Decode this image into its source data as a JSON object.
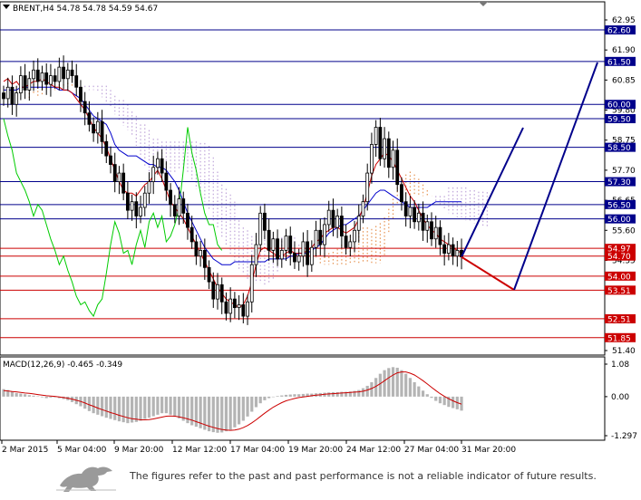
{
  "header": {
    "symbol_line": "BRENT,H4  54.78 54.78 54.59 54.67",
    "macd_label": "MACD(12,26,9) -0.465 -0.349"
  },
  "disclaimer": "The figures refer to the past and past performance is not a reliable indicator of future results.",
  "colors": {
    "blue_level": "#00008b",
    "red_level": "#cc0000",
    "candle": "#000000",
    "tenkan": "#cc0000",
    "kijun": "#0000cc",
    "chikou": "#00cc00",
    "cloud_orange": "#e07a2a",
    "cloud_purple": "#b08fd0",
    "forecast_up": "#00008b",
    "forecast_down": "#cc0000",
    "macd_hist": "#b4b4b4",
    "macd_signal": "#cc0000"
  },
  "chart_data": {
    "type": "candlestick",
    "instrument": "BRENT",
    "timeframe": "H4",
    "ohlc_header": {
      "open": 54.78,
      "high": 54.78,
      "low": 54.59,
      "close": 54.67
    },
    "ylim": [
      51.0,
      63.5
    ],
    "y_ticks": [
      62.95,
      61.9,
      60.85,
      59.8,
      58.75,
      57.7,
      56.65,
      55.6,
      54.55,
      53.5,
      52.45,
      51.4
    ],
    "x_tick_labels": [
      "2 Mar 2015",
      "5 Mar 04:00",
      "9 Mar 20:00",
      "12 Mar 12:00",
      "17 Mar 04:00",
      "19 Mar 20:00",
      "24 Mar 12:00",
      "27 Mar 04:00",
      "31 Mar 20:00"
    ],
    "levels": [
      {
        "value": 62.6,
        "label": "62.60",
        "color": "blue"
      },
      {
        "value": 61.5,
        "label": "61.50",
        "color": "blue"
      },
      {
        "value": 60.0,
        "label": "60.00",
        "color": "blue"
      },
      {
        "value": 59.5,
        "label": "59.50",
        "color": "blue"
      },
      {
        "value": 58.5,
        "label": "58.50",
        "color": "blue"
      },
      {
        "value": 57.3,
        "label": "57.30",
        "color": "blue"
      },
      {
        "value": 56.5,
        "label": "56.50",
        "color": "blue"
      },
      {
        "value": 56.0,
        "label": "56.00",
        "color": "blue"
      },
      {
        "value": 54.97,
        "label": "54.97",
        "color": "red"
      },
      {
        "value": 54.7,
        "label": "54.70",
        "color": "red"
      },
      {
        "value": 54.0,
        "label": "54.00",
        "color": "red"
      },
      {
        "value": 53.51,
        "label": "53.51",
        "color": "red"
      },
      {
        "value": 52.51,
        "label": "52.51",
        "color": "red"
      },
      {
        "value": 51.85,
        "label": "51.85",
        "color": "red"
      }
    ],
    "closes": [
      60.2,
      60.6,
      60.0,
      60.4,
      61.0,
      60.5,
      60.9,
      61.2,
      60.8,
      61.1,
      60.7,
      61.0,
      60.8,
      61.3,
      60.9,
      61.2,
      61.0,
      60.6,
      60.1,
      59.7,
      59.3,
      59.0,
      59.4,
      58.7,
      58.2,
      57.9,
      57.3,
      57.6,
      56.9,
      56.3,
      56.6,
      56.1,
      56.4,
      56.9,
      57.3,
      57.8,
      58.1,
      57.6,
      57.0,
      56.5,
      56.1,
      56.7,
      56.2,
      55.7,
      55.2,
      54.7,
      54.9,
      54.3,
      53.8,
      53.2,
      53.7,
      53.1,
      52.7,
      53.2,
      52.9,
      53.0,
      52.6,
      53.1,
      54.4,
      55.1,
      56.2,
      55.6,
      54.9,
      55.3,
      54.6,
      54.9,
      55.4,
      54.8,
      54.5,
      54.7,
      55.2,
      54.4,
      55.0,
      55.6,
      55.1,
      55.8,
      56.3,
      55.7,
      56.1,
      55.4,
      55.0,
      55.2,
      55.6,
      56.1,
      56.6,
      57.6,
      58.6,
      59.2,
      58.1,
      58.8,
      57.8,
      58.4,
      57.2,
      56.6,
      56.1,
      56.4,
      55.9,
      56.2,
      55.6,
      55.9,
      55.3,
      55.7,
      55.1,
      54.8,
      55.1,
      54.7,
      54.9,
      54.67
    ],
    "tenkan": [
      60.8,
      60.9,
      60.7,
      60.8,
      60.6,
      60.6,
      60.7,
      60.8,
      60.8,
      60.9,
      60.8,
      60.7,
      60.6,
      60.6,
      60.5,
      60.5,
      60.4,
      60.2,
      60.0,
      59.8,
      59.5,
      59.2,
      59.0,
      58.8,
      58.5,
      58.1,
      57.7,
      57.3,
      57.0,
      56.9,
      56.9,
      56.8,
      57.0,
      57.2,
      57.3,
      57.5,
      57.7,
      57.4,
      57.0,
      56.6,
      56.4,
      56.2,
      56.0,
      55.7,
      55.4,
      55.1,
      54.8,
      54.5,
      54.2,
      53.9,
      53.6,
      53.4,
      53.2,
      53.1,
      53.0,
      52.9,
      53.0,
      53.3,
      53.8,
      54.4,
      54.9,
      55.0,
      54.9,
      54.8,
      54.7,
      54.7,
      54.8,
      54.9,
      54.8,
      54.8,
      54.8,
      54.9,
      55.0,
      55.2,
      55.3,
      55.5,
      55.6,
      55.7,
      55.7,
      55.6,
      55.5,
      55.6,
      55.7,
      56.0,
      56.4,
      56.9,
      57.5,
      57.9,
      58.1,
      58.3,
      58.2,
      58.0,
      57.7,
      57.4,
      57.1,
      56.8,
      56.6,
      56.3,
      56.0,
      55.8,
      55.6,
      55.5,
      55.3,
      55.2,
      55.1,
      55.0,
      54.9,
      54.8
    ],
    "kijun": [
      60.5,
      60.5,
      60.5,
      60.5,
      60.6,
      60.6,
      60.6,
      60.6,
      60.6,
      60.6,
      60.6,
      60.6,
      60.6,
      60.5,
      60.5,
      60.5,
      60.4,
      60.3,
      60.2,
      60.0,
      59.8,
      59.6,
      59.5,
      59.4,
      59.3,
      59.0,
      58.6,
      58.4,
      58.3,
      58.2,
      58.2,
      58.2,
      58.1,
      58.0,
      57.9,
      57.9,
      57.8,
      57.8,
      57.7,
      57.5,
      57.3,
      57.0,
      56.6,
      56.2,
      55.9,
      55.6,
      55.3,
      55.0,
      54.8,
      54.6,
      54.5,
      54.4,
      54.4,
      54.4,
      54.5,
      54.5,
      54.5,
      54.5,
      54.5,
      54.5,
      54.5,
      54.5,
      54.6,
      54.6,
      54.6,
      54.6,
      54.6,
      54.7,
      54.7,
      54.8,
      54.8,
      54.8,
      54.9,
      55.0,
      55.1,
      55.3,
      55.5,
      55.6,
      55.7,
      55.8,
      55.8,
      55.9,
      56.0,
      56.1,
      56.3,
      56.5,
      56.7,
      56.9,
      57.0,
      57.0,
      56.9,
      56.8,
      56.7,
      56.6,
      56.5,
      56.4,
      56.4,
      56.4,
      56.4,
      56.4,
      56.5,
      56.6,
      56.6,
      56.6,
      56.6,
      56.6,
      56.6,
      56.6
    ],
    "chikou": [
      59.5,
      58.9,
      58.4,
      57.6,
      57.3,
      57.0,
      56.6,
      56.1,
      56.5,
      56.3,
      55.8,
      55.3,
      54.9,
      54.4,
      54.7,
      54.2,
      53.8,
      53.3,
      53.0,
      53.1,
      52.8,
      52.6,
      53.0,
      53.2,
      54.1,
      55.1,
      55.9,
      55.5,
      54.8,
      54.9,
      54.4,
      55.1,
      55.6,
      55.0,
      55.9,
      56.2,
      55.7,
      56.1,
      55.2,
      55.4,
      55.8,
      56.4,
      57.7,
      59.2,
      58.3,
      57.7,
      56.9,
      56.2,
      55.8,
      55.8,
      55.1,
      54.9
    ]
  },
  "macd_data": {
    "ylim": [
      -1.297,
      1.08
    ],
    "y_ticks": [
      1.08,
      0.0,
      -1.297
    ],
    "hist": [
      0.25,
      0.22,
      0.18,
      0.12,
      0.1,
      0.08,
      0.05,
      0.03,
      0.01,
      -0.02,
      -0.05,
      -0.03,
      -0.02,
      -0.05,
      -0.08,
      -0.12,
      -0.18,
      -0.25,
      -0.32,
      -0.4,
      -0.48,
      -0.55,
      -0.6,
      -0.65,
      -0.7,
      -0.74,
      -0.78,
      -0.82,
      -0.85,
      -0.88,
      -0.86,
      -0.84,
      -0.8,
      -0.74,
      -0.7,
      -0.65,
      -0.6,
      -0.55,
      -0.55,
      -0.6,
      -0.66,
      -0.72,
      -0.8,
      -0.88,
      -0.95,
      -1.0,
      -1.05,
      -1.1,
      -1.15,
      -1.18,
      -1.2,
      -1.19,
      -1.15,
      -1.1,
      -1.02,
      -0.92,
      -0.8,
      -0.66,
      -0.5,
      -0.35,
      -0.22,
      -0.12,
      -0.05,
      0.0,
      0.02,
      0.04,
      0.06,
      0.07,
      0.08,
      0.08,
      0.09,
      0.1,
      0.1,
      0.11,
      0.12,
      0.13,
      0.14,
      0.15,
      0.15,
      0.16,
      0.16,
      0.17,
      0.19,
      0.22,
      0.28,
      0.36,
      0.48,
      0.62,
      0.76,
      0.88,
      0.95,
      0.98,
      0.96,
      0.88,
      0.76,
      0.62,
      0.48,
      0.34,
      0.2,
      0.08,
      -0.04,
      -0.14,
      -0.22,
      -0.28,
      -0.34,
      -0.38,
      -0.42,
      -0.465
    ],
    "signal": [
      0.2,
      0.19,
      0.17,
      0.16,
      0.14,
      0.12,
      0.11,
      0.09,
      0.07,
      0.05,
      0.03,
      0.02,
      0.01,
      -0.01,
      -0.03,
      -0.05,
      -0.08,
      -0.12,
      -0.16,
      -0.21,
      -0.27,
      -0.32,
      -0.38,
      -0.43,
      -0.48,
      -0.53,
      -0.57,
      -0.62,
      -0.66,
      -0.7,
      -0.73,
      -0.75,
      -0.77,
      -0.77,
      -0.76,
      -0.74,
      -0.71,
      -0.68,
      -0.65,
      -0.64,
      -0.65,
      -0.67,
      -0.7,
      -0.74,
      -0.78,
      -0.83,
      -0.88,
      -0.93,
      -0.98,
      -1.02,
      -1.06,
      -1.09,
      -1.11,
      -1.12,
      -1.11,
      -1.08,
      -1.03,
      -0.96,
      -0.87,
      -0.77,
      -0.66,
      -0.55,
      -0.45,
      -0.35,
      -0.27,
      -0.2,
      -0.14,
      -0.1,
      -0.06,
      -0.03,
      -0.01,
      0.01,
      0.03,
      0.05,
      0.06,
      0.08,
      0.09,
      0.1,
      0.11,
      0.12,
      0.13,
      0.14,
      0.15,
      0.16,
      0.18,
      0.22,
      0.27,
      0.34,
      0.43,
      0.53,
      0.63,
      0.72,
      0.79,
      0.82,
      0.82,
      0.78,
      0.72,
      0.63,
      0.53,
      0.42,
      0.31,
      0.2,
      0.1,
      0.01,
      -0.07,
      -0.14,
      -0.2,
      -0.25
    ]
  }
}
